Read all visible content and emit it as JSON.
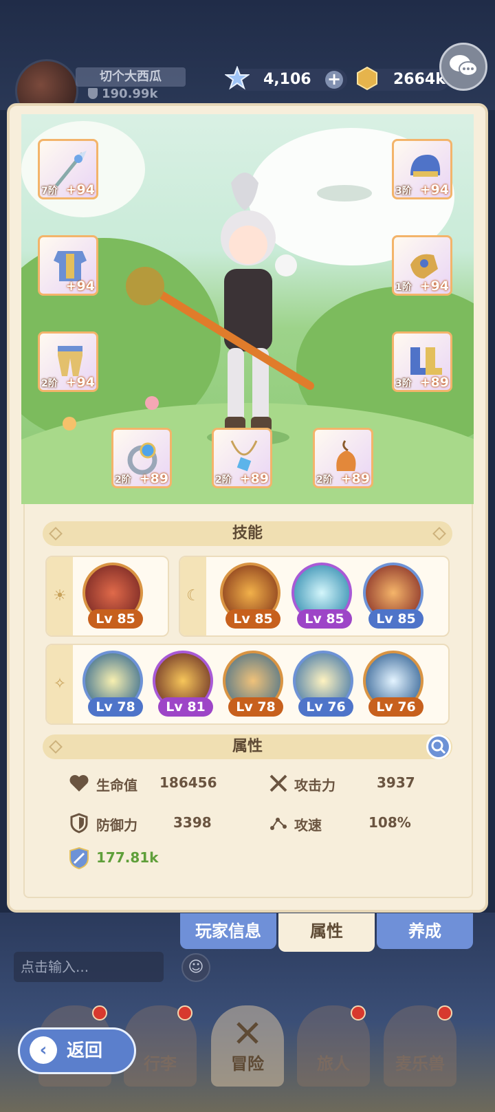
{
  "header": {
    "player_name": "切个大西瓜",
    "player_power": "190.99k",
    "gem_count": "4,106",
    "gold_count": "2664k"
  },
  "equipment": [
    {
      "slot": "weapon",
      "tier": "7阶",
      "plus": "+94"
    },
    {
      "slot": "helmet",
      "tier": "3阶",
      "plus": "+94"
    },
    {
      "slot": "armor",
      "tier": "",
      "plus": "+94"
    },
    {
      "slot": "gauntlet",
      "tier": "1阶",
      "plus": "+94"
    },
    {
      "slot": "pants",
      "tier": "2阶",
      "plus": "+94"
    },
    {
      "slot": "boots",
      "tier": "3阶",
      "plus": "+89"
    },
    {
      "slot": "ring",
      "tier": "2阶",
      "plus": "+89"
    },
    {
      "slot": "necklace",
      "tier": "2阶",
      "plus": "+89"
    },
    {
      "slot": "charm",
      "tier": "2阶",
      "plus": "+89"
    }
  ],
  "skills": {
    "title": "技能",
    "sun_group": [
      {
        "level": "Lv 85",
        "color": "#c7601d"
      }
    ],
    "moon_group": [
      {
        "level": "Lv 85",
        "color": "#c7601d"
      },
      {
        "level": "Lv 85",
        "color": "#9d45c7"
      },
      {
        "level": "Lv 85",
        "color": "#4e74c9"
      }
    ],
    "star_group": [
      {
        "level": "Lv 78",
        "color": "#4e74c9"
      },
      {
        "level": "Lv 81",
        "color": "#9d45c7"
      },
      {
        "level": "Lv 78",
        "color": "#c7601d"
      },
      {
        "level": "Lv 76",
        "color": "#4e74c9"
      },
      {
        "level": "Lv 76",
        "color": "#c7601d"
      }
    ]
  },
  "attributes": {
    "title": "属性",
    "hp_label": "生命值",
    "hp_value": "186456",
    "attack_label": "攻击力",
    "attack_value": "3937",
    "defense_label": "防御力",
    "defense_value": "3398",
    "speed_label": "攻速",
    "speed_value": "108%",
    "power_value": "177.81k"
  },
  "tabs": {
    "player_info": "玩家信息",
    "attributes": "属性",
    "cultivate": "养成"
  },
  "chat": {
    "placeholder": "点击输入..."
  },
  "nav": {
    "back": "返回",
    "luggage": "行李",
    "adventure": "冒险",
    "traveler": "旅人",
    "pet": "麦乐兽"
  }
}
